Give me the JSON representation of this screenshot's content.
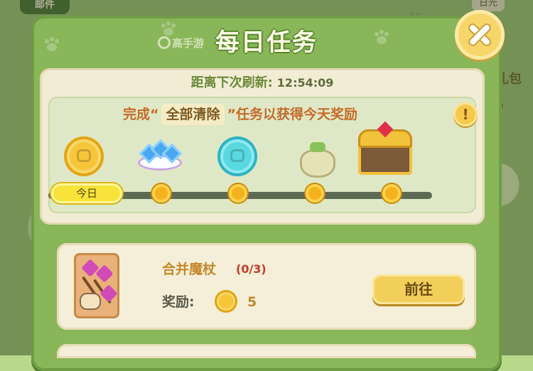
{
  "background": {
    "mail_tab": "邮件",
    "top_right_label": "日光",
    "counter": "10",
    "newbie_label": "新手礼包",
    "newbie_num": "16"
  },
  "dialog": {
    "title": "每日任务",
    "watermark": "高手游",
    "refresh": {
      "label": "距离下次刷新:",
      "time": "12:54:09"
    },
    "goal": {
      "prefix": "完成“",
      "highlight": "全部清除",
      "suffix": "”任务以获得今天奖励",
      "info_symbol": "!"
    },
    "rewards": [
      {
        "icon": "gold-coin-icon"
      },
      {
        "icon": "gems-icon"
      },
      {
        "icon": "teal-coin-icon"
      },
      {
        "icon": "sack-icon"
      },
      {
        "icon": "treasure-chest-icon"
      }
    ],
    "today_label": "今日",
    "progress_fraction": 0.0
  },
  "task": {
    "name": "合并魔杖",
    "progress": "(0/3)",
    "reward_label": "奖励:",
    "reward_amount": "5",
    "go_label": "前往"
  },
  "colors": {
    "dialog_green": "#8ab65a",
    "panel_cream": "#f2ecd5",
    "gold": "#f6c53a",
    "accent_red": "#c23a2a"
  }
}
